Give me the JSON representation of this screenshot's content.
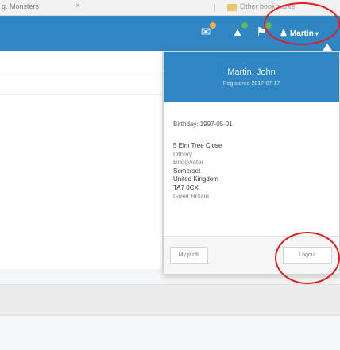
{
  "browser": {
    "tab_text": "g. Monsters",
    "tab_close": "×",
    "bookmark_text": "Other bookmarks"
  },
  "navbar": {
    "icons": [
      {
        "name": "envelope-icon",
        "glyph": "✉"
      },
      {
        "name": "warning-icon",
        "glyph": "▲"
      },
      {
        "name": "flag-icon",
        "glyph": "⚑"
      }
    ],
    "user_label": "Martin",
    "user_icon_glyph": "♟",
    "caret_glyph": "▾",
    "accent_color": "#2f86c3",
    "badge_colors": [
      "#f0ad4e",
      "#5cb85c",
      "#5cb85c"
    ]
  },
  "dropdown": {
    "user_name": "Martin, John",
    "member_since": "Registered 2017-07-17",
    "birthday": "Birthday: 1997-05-01",
    "address": [
      "5 Elm Tree Close",
      "Othery",
      "Bridgwater",
      "Somerset",
      "United Kingdom",
      "TA7 0CX",
      "Great Britain"
    ],
    "profile_button": "My profil",
    "logout_button": "Logout"
  }
}
